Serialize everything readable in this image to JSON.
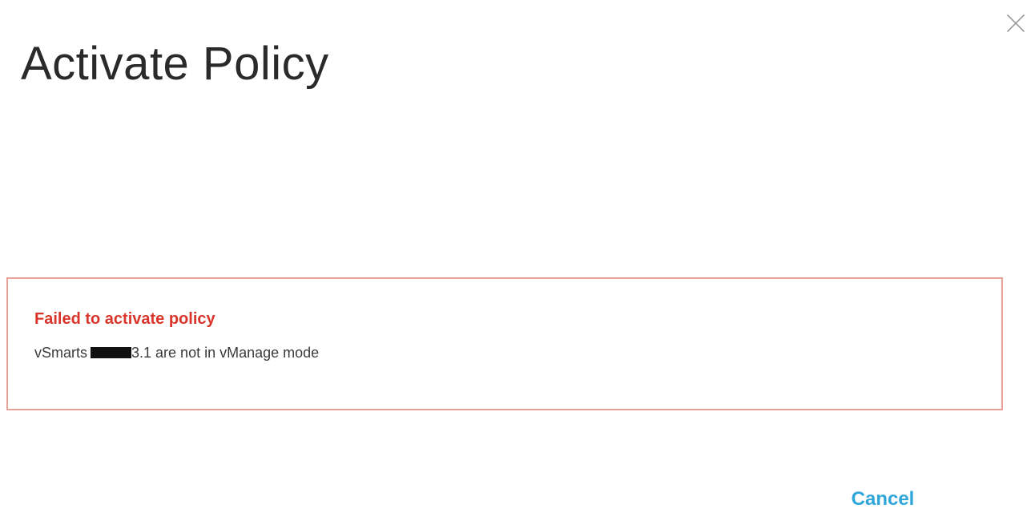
{
  "dialog": {
    "title": "Activate Policy",
    "close_icon": "close-icon"
  },
  "alert": {
    "title": "Failed to activate policy",
    "message_prefix": "vSmarts",
    "message_suffix": "3.1 are not in vManage mode",
    "border_color": "#e9a29a",
    "title_color": "#d9352a"
  },
  "actions": {
    "cancel_label": "Cancel",
    "cancel_color": "#2fa6d9"
  }
}
